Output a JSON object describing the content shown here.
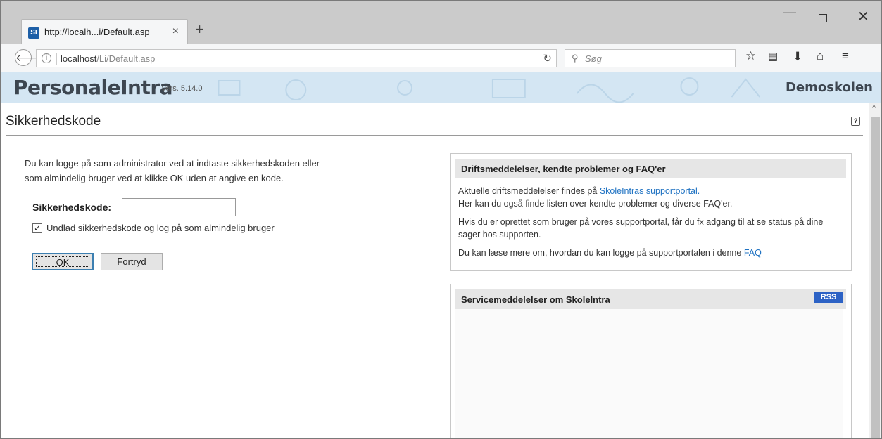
{
  "browser": {
    "tab_title": "http://localh...i/Default.asp",
    "tab_favicon": "SI",
    "tab_close": "×",
    "new_tab": "+",
    "url_host": "localhost",
    "url_path": "/Li/Default.asp",
    "search_placeholder": "Søg",
    "icons": [
      "back-arrow-icon",
      "info-icon",
      "reload-icon",
      "search-icon",
      "bookmark-star-icon",
      "reader-icon",
      "download-icon",
      "home-icon",
      "menu-icon"
    ]
  },
  "header": {
    "brand": "PersonaleIntra",
    "version": "vers. 5.14.0",
    "school": "Demoskolen"
  },
  "page": {
    "title": "Sikkerhedskode",
    "help": "?",
    "intro_line1": "Du kan logge på som administrator ved at indtaste sikkerhedskoden eller",
    "intro_line2": "som almindelig bruger ved at klikke OK uden at angive en kode.",
    "code_label": "Sikkerhedskode:",
    "code_value": "",
    "checkbox_checked": true,
    "checkbox_label": "Undlad sikkerhedskode og log på som almindelig bruger",
    "ok_label": "OK",
    "cancel_label": "Fortryd"
  },
  "panel_ops": {
    "title": "Driftsmeddelelser, kendte problemer og FAQ'er",
    "p1_pre": "Aktuelle driftsmeddelelser findes på ",
    "p1_link": "SkoleIntras supportportal.",
    "p1_line2": "Her kan du også finde listen over kendte problemer og diverse FAQ'er.",
    "p2": "Hvis du er oprettet som bruger på vores supportportal, får du fx adgang til at se status på dine sager hos supporten.",
    "p3_pre": "Du kan læse mere om, hvordan du kan logge på supportportalen i denne ",
    "p3_link": "FAQ"
  },
  "panel_service": {
    "title": "Servicemeddelelser om SkoleIntra",
    "rss": "RSS"
  },
  "colors": {
    "banner_bg": "#d4e6f3",
    "link": "#1f72c2",
    "rss_bg": "#2c62c5"
  }
}
